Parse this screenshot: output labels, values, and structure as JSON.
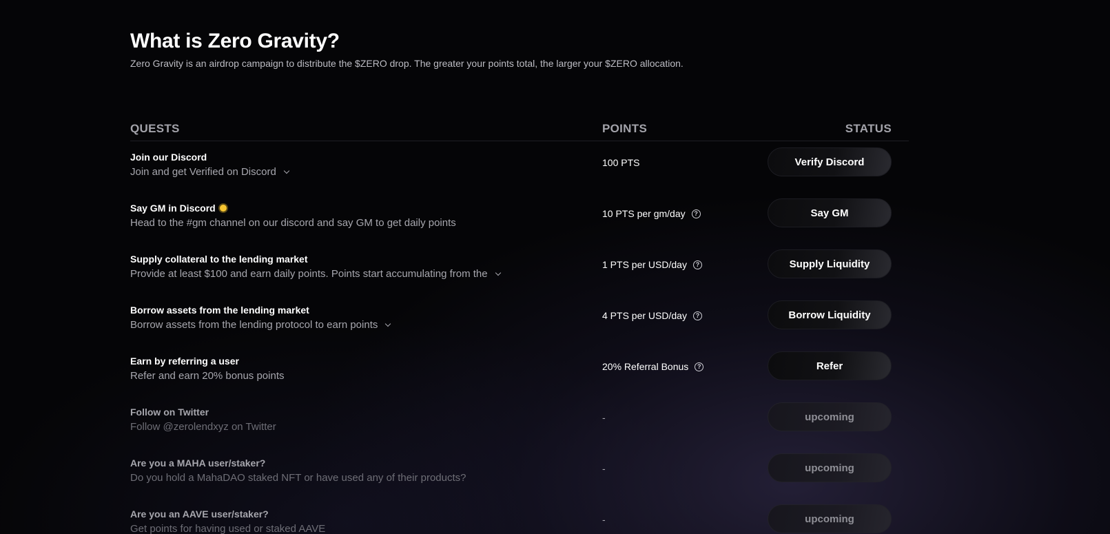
{
  "header": {
    "title": "What is Zero Gravity?",
    "subtitle": "Zero Gravity is an airdrop campaign to distribute the $ZERO drop. The greater your points total, the larger your $ZERO allocation."
  },
  "table": {
    "columns": {
      "quests": "QUESTS",
      "points": "POINTS",
      "status": "STATUS"
    },
    "rows": [
      {
        "title": "Join our Discord",
        "description": "Join and get Verified on Discord",
        "points": "100 PTS",
        "action": "Verify Discord"
      },
      {
        "title": "Say GM in Discord",
        "description": "Head to the #gm channel on our discord and say GM to get daily points",
        "points": "10 PTS per gm/day",
        "action": "Say GM"
      },
      {
        "title": "Supply collateral to the lending market",
        "description": "Provide at least $100 and earn daily points. Points start accumulating from the",
        "points": "1 PTS per USD/day",
        "action": "Supply Liquidity"
      },
      {
        "title": "Borrow assets from the lending market",
        "description": "Borrow assets from the lending protocol to earn points",
        "points": "4 PTS per USD/day",
        "action": "Borrow Liquidity"
      },
      {
        "title": "Earn by referring a user",
        "description": "Refer and earn 20% bonus points",
        "points": "20% Referral Bonus",
        "action": "Refer"
      },
      {
        "title": "Follow on Twitter",
        "description": "Follow @zerolendxyz on Twitter",
        "points": "-",
        "action": "upcoming"
      },
      {
        "title": "Are you a MAHA user/staker?",
        "description": "Do you hold a MahaDAO staked NFT or have used any of their products?",
        "points": "-",
        "action": "upcoming"
      },
      {
        "title": "Are you an AAVE user/staker?",
        "description": "Get points for having used or staked AAVE",
        "points": "-",
        "action": "upcoming"
      }
    ]
  },
  "icons": {
    "sun": "sun-icon",
    "help": "help-circle-icon",
    "chevron": "chevron-down-icon"
  },
  "colors": {
    "accent_sun": "#f7c531",
    "background": "#050507"
  }
}
